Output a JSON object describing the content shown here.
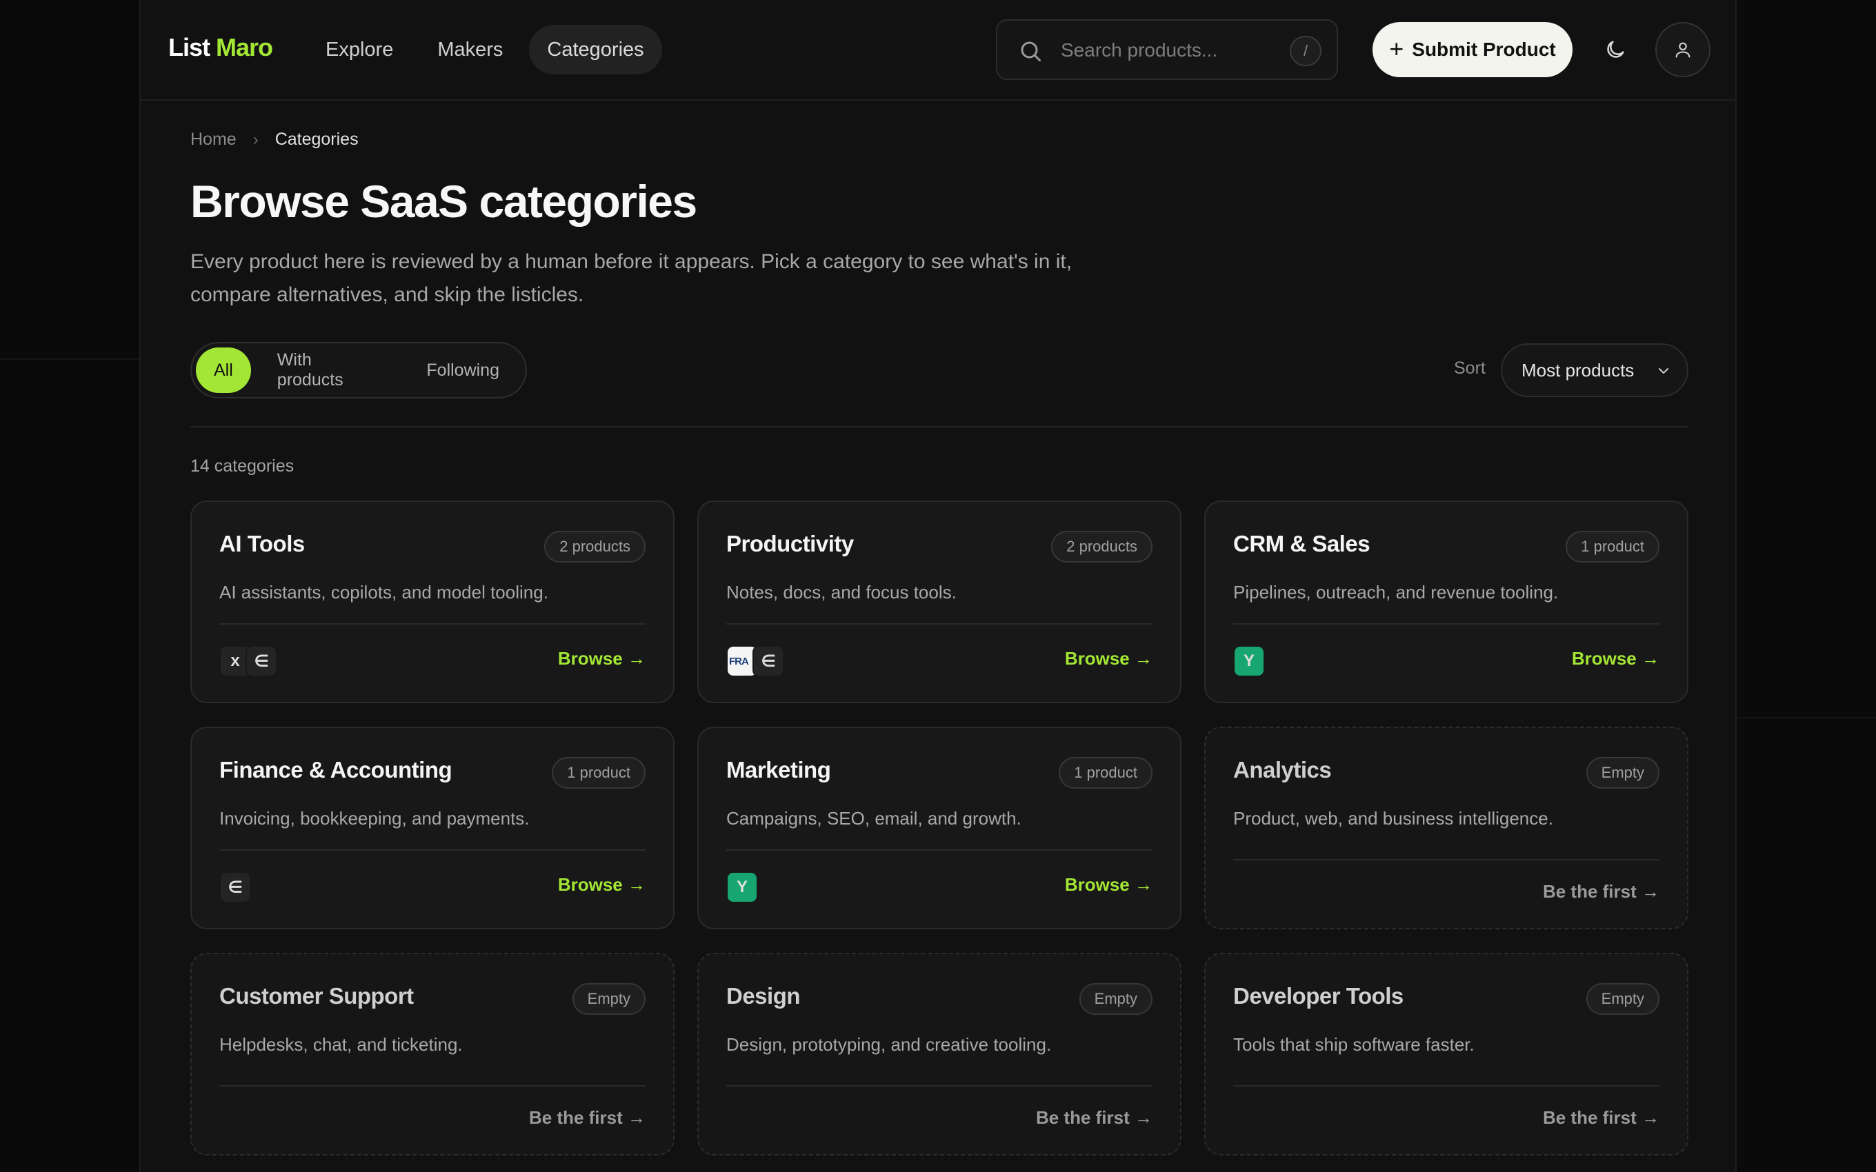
{
  "header": {
    "logo_part1": "List",
    "logo_part2": "Maro",
    "nav": [
      "Explore",
      "Makers",
      "Categories"
    ],
    "search_placeholder": "Search products...",
    "search_shortcut": "/",
    "submit_label": "Submit Product"
  },
  "breadcrumb": {
    "home": "Home",
    "current": "Categories"
  },
  "page": {
    "title": "Browse SaaS categories",
    "description": "Every product here is reviewed by a human before it appears. Pick a category to see what's in it, compare alternatives, and skip the listicles."
  },
  "filters": {
    "all": "All",
    "with_products": "With products",
    "following": "Following"
  },
  "sort": {
    "label": "Sort",
    "value": "Most products"
  },
  "count_label": "14 categories",
  "colors": {
    "accent": "#a3e635",
    "background": "#111111",
    "icon_green": "#17a672"
  },
  "categories": [
    {
      "name": "AI Tools",
      "badge": "2 products",
      "desc": "AI assistants, copilots, and model tooling.",
      "action": "Browse →",
      "icons": [
        "x",
        "∈"
      ]
    },
    {
      "name": "Productivity",
      "badge": "2 products",
      "desc": "Notes, docs, and focus tools.",
      "action": "Browse →",
      "icons": [
        "FRA",
        "∈"
      ]
    },
    {
      "name": "CRM & Sales",
      "badge": "1 product",
      "desc": "Pipelines, outreach, and revenue tooling.",
      "action": "Browse →",
      "icons": [
        "Y"
      ]
    },
    {
      "name": "Finance & Accounting",
      "badge": "1 product",
      "desc": "Invoicing, bookkeeping, and payments.",
      "action": "Browse →",
      "icons": [
        "∈"
      ]
    },
    {
      "name": "Marketing",
      "badge": "1 product",
      "desc": "Campaigns, SEO, email, and growth.",
      "action": "Browse →",
      "icons": [
        "Y"
      ]
    },
    {
      "name": "Analytics",
      "badge": "Empty",
      "desc": "Product, web, and business intelligence.",
      "action": "Be the first →"
    },
    {
      "name": "Customer Support",
      "badge": "Empty",
      "desc": "Helpdesks, chat, and ticketing.",
      "action": "Be the first →"
    },
    {
      "name": "Design",
      "badge": "Empty",
      "desc": "Design, prototyping, and creative tooling.",
      "action": "Be the first →"
    },
    {
      "name": "Developer Tools",
      "badge": "Empty",
      "desc": "Tools that ship software faster.",
      "action": "Be the first →"
    }
  ]
}
